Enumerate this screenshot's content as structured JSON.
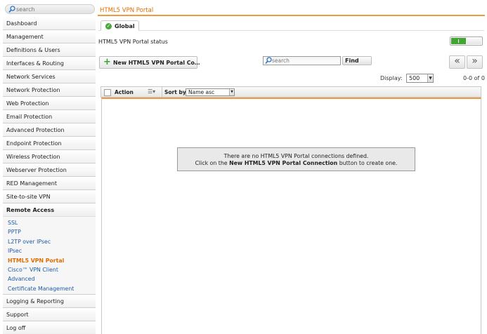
{
  "sidebar": {
    "search_placeholder": "search",
    "items_top": [
      {
        "label": "Dashboard"
      },
      {
        "label": "Management"
      },
      {
        "label": "Definitions & Users"
      },
      {
        "label": "Interfaces & Routing"
      },
      {
        "label": "Network Services"
      },
      {
        "label": "Network Protection"
      },
      {
        "label": "Web Protection"
      },
      {
        "label": "Email Protection"
      },
      {
        "label": "Advanced Protection"
      },
      {
        "label": "Endpoint Protection"
      },
      {
        "label": "Wireless Protection"
      },
      {
        "label": "Webserver Protection"
      },
      {
        "label": "RED Management"
      },
      {
        "label": "Site-to-site VPN"
      }
    ],
    "group": {
      "label": "Remote Access",
      "subitems": [
        {
          "label": "SSL"
        },
        {
          "label": "PPTP"
        },
        {
          "label": "L2TP over IPsec"
        },
        {
          "label": "IPsec"
        },
        {
          "label": "HTML5 VPN Portal",
          "active": true
        },
        {
          "label": "Cisco™ VPN Client"
        },
        {
          "label": "Advanced"
        },
        {
          "label": "Certificate Management"
        }
      ]
    },
    "items_bottom": [
      {
        "label": "Logging & Reporting"
      },
      {
        "label": "Support"
      },
      {
        "label": "Log off"
      }
    ]
  },
  "header": {
    "breadcrumb": "HTML5 VPN Portal"
  },
  "tabs": {
    "global_label": "Global"
  },
  "status": {
    "label": "HTML5 VPN Portal status",
    "enabled": true
  },
  "toolbar": {
    "new_button_label": "New HTML5 VPN Portal Co…",
    "search_placeholder": "search",
    "find_label": "Find",
    "prev_label": "«",
    "next_label": "»"
  },
  "paging": {
    "display_label": "Display:",
    "display_value": "500",
    "range": "0-0 of 0"
  },
  "list_header": {
    "action_label": "Action",
    "sort_label": "Sort by:",
    "sort_value": "Name asc"
  },
  "empty_state": {
    "line1": "There are no HTML5 VPN Portal connections defined.",
    "line2_prefix": "Click on the ",
    "line2_bold": "New HTML5 VPN Portal Connection",
    "line2_suffix": " button to create one."
  },
  "colors": {
    "accent": "#ee9a3d",
    "breadcrumb": "#e06d00",
    "link": "#1f5aa6",
    "toggle_on": "#40a532"
  }
}
